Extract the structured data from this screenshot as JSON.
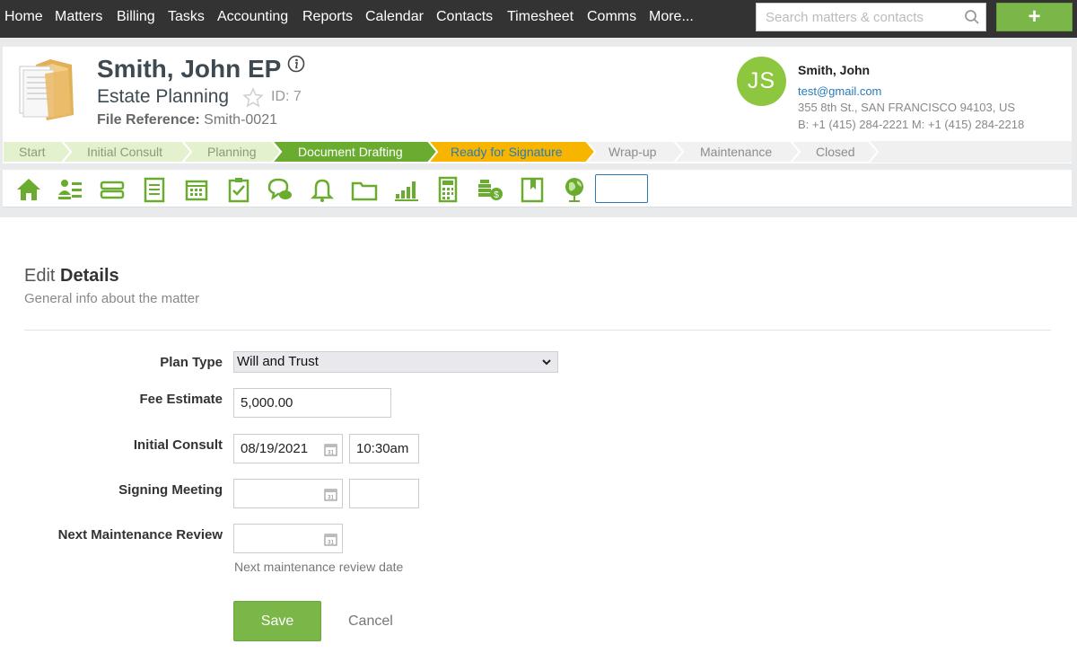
{
  "nav": {
    "items": [
      "Home",
      "Matters",
      "Billing",
      "Tasks",
      "Accounting",
      "Reports",
      "Calendar",
      "Contacts",
      "Timesheet",
      "Comms",
      "More..."
    ],
    "search_placeholder": "Search matters & contacts",
    "add_label": "+"
  },
  "matter": {
    "title": "Smith, John EP",
    "type": "Estate Planning",
    "id_label": "ID: 7",
    "file_ref_label": "File Reference:",
    "file_ref_value": "Smith-0021"
  },
  "contact": {
    "initials": "JS",
    "name": "Smith, John",
    "email": "test@gmail.com",
    "address": "355 8th St., SAN FRANCISCO 94103, US",
    "phones": "B: +1 (415) 284-2221  M: +1 (415) 284-2218"
  },
  "stages": [
    {
      "label": "Start",
      "state": "done"
    },
    {
      "label": "Initial Consult",
      "state": "done"
    },
    {
      "label": "Planning",
      "state": "done"
    },
    {
      "label": "Document Drafting",
      "state": "complete"
    },
    {
      "label": "Ready for Signature",
      "state": "current"
    },
    {
      "label": "Wrap-up",
      "state": "todo"
    },
    {
      "label": "Maintenance",
      "state": "todo"
    },
    {
      "label": "Closed",
      "state": "todo"
    }
  ],
  "stage_colors": {
    "done": "#e4f1cf",
    "complete": "#6aac2f",
    "current": "#f7b500",
    "todo": "#f1f1f1",
    "done_text": "#8c9a79",
    "complete_text": "#ffffff",
    "current_text": "#2a7ab8",
    "todo_text": "#8c8c8c"
  },
  "toolbar_icons": [
    "home-icon",
    "contacts-list-icon",
    "billing-icon",
    "notes-icon",
    "calendar-icon",
    "tasks-icon",
    "comments-icon",
    "bell-icon",
    "folder-icon",
    "reports-icon",
    "calculator-icon",
    "money-icon",
    "book-icon",
    "globe-icon"
  ],
  "accent_color": "#7ab648",
  "form": {
    "title_light": "Edit",
    "title_bold": "Details",
    "subtitle": "General info about the matter",
    "plan_type_label": "Plan Type",
    "plan_type_value": "Will and Trust",
    "fee_label": "Fee Estimate",
    "fee_value": "5,000.00",
    "initial_consult_label": "Initial Consult",
    "initial_consult_date": "08/19/2021",
    "initial_consult_time": "10:30am",
    "signing_label": "Signing Meeting",
    "signing_date": "",
    "signing_time": "",
    "next_review_label": "Next Maintenance Review",
    "next_review_date": "",
    "next_review_help": "Next maintenance review date",
    "save_label": "Save",
    "cancel_label": "Cancel"
  }
}
